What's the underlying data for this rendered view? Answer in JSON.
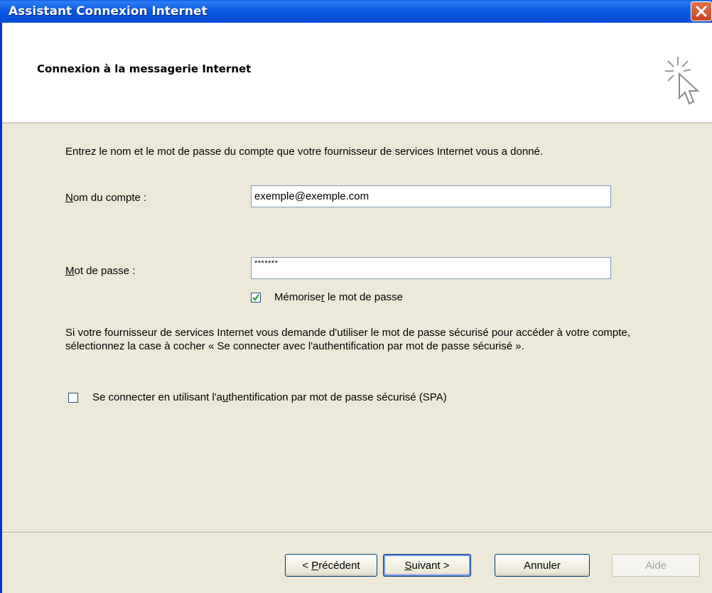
{
  "window": {
    "title": "Assistant Connexion Internet"
  },
  "header": {
    "title": "Connexion à la messagerie Internet"
  },
  "form": {
    "intro": "Entrez le nom et le mot de passe du compte que votre fournisseur de services Internet vous a donné.",
    "account_label": "Nom du compte :",
    "account_value": "exemple@exemple.com",
    "password_label": "Mot de passe :",
    "password_value": "*******",
    "remember_label": "Mémoriser le mot de passe",
    "remember_checked": true,
    "spa_info": "Si votre fournisseur de services Internet vous demande d'utiliser le mot de passe sécurisé pour accéder à votre compte, sélectionnez la case à cocher « Se connecter avec l'authentification par mot de passe sécurisé ».",
    "spa_label": "Se connecter en utilisant l'authentification par mot de passe sécurisé (SPA)",
    "spa_checked": false
  },
  "buttons": {
    "previous": "< Précédent",
    "next": "Suivant >",
    "cancel": "Annuler",
    "help": "Aide"
  },
  "icons": {
    "close": "close-icon",
    "wizard": "wizard-cursor-icon",
    "check": "check-icon"
  },
  "colors": {
    "titlebar": "#0a5ae3",
    "dialog_bg": "#ece9d8",
    "close_button": "#c9421f"
  }
}
